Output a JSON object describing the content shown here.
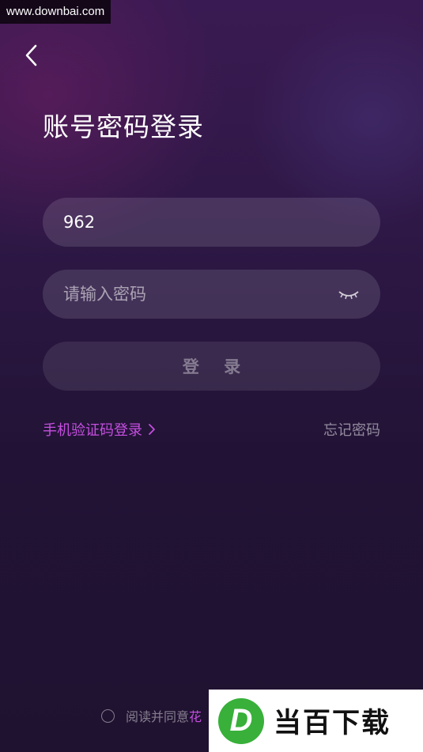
{
  "watermark": {
    "site": "www.downbai.com",
    "brand": "当百下载",
    "logo_letter": "D"
  },
  "header": {
    "title": "账号密码登录"
  },
  "form": {
    "account_value": "962",
    "password_placeholder": "请输入密码",
    "login_label": "登 录"
  },
  "links": {
    "sms_login": "手机验证码登录",
    "forgot": "忘记密码"
  },
  "agreement": {
    "prefix": "阅读并同意",
    "link": "花"
  },
  "colors": {
    "accent": "#c64fe0",
    "brand_green": "#38b03a"
  }
}
